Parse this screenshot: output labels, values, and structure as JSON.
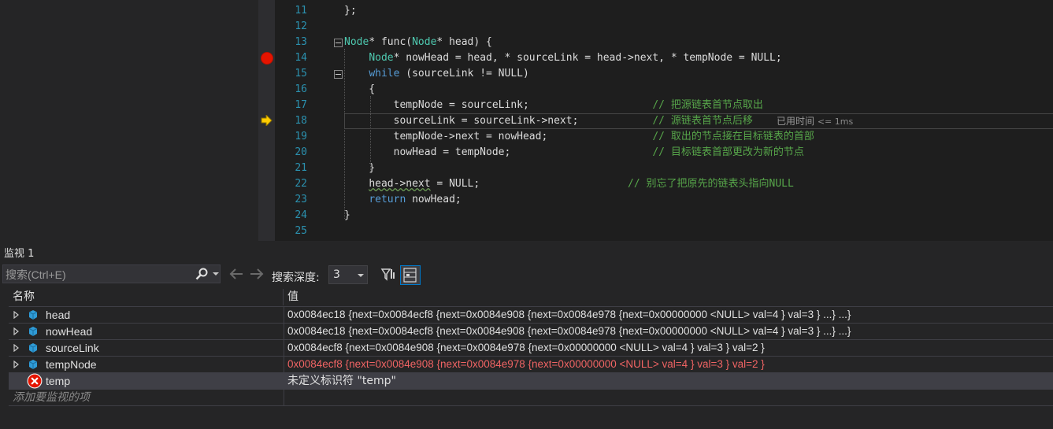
{
  "editor": {
    "lines": [
      {
        "num": "11",
        "parts": [
          {
            "t": "};",
            "c": "pl"
          }
        ]
      },
      {
        "num": "12",
        "parts": []
      },
      {
        "num": "13",
        "parts": [
          {
            "t": "Node",
            "c": "ty"
          },
          {
            "t": "* func(",
            "c": "pl"
          },
          {
            "t": "Node",
            "c": "ty"
          },
          {
            "t": "* head) {",
            "c": "pl"
          }
        ]
      },
      {
        "num": "14",
        "parts": [
          {
            "t": "    ",
            "c": "pl"
          },
          {
            "t": "Node",
            "c": "ty"
          },
          {
            "t": "* nowHead = head, * sourceLink = head->next, * tempNode = NULL;",
            "c": "pl"
          }
        ]
      },
      {
        "num": "15",
        "parts": [
          {
            "t": "    ",
            "c": "pl"
          },
          {
            "t": "while",
            "c": "kw"
          },
          {
            "t": " (sourceLink != NULL)",
            "c": "pl"
          }
        ]
      },
      {
        "num": "16",
        "parts": [
          {
            "t": "    {",
            "c": "pl"
          }
        ]
      },
      {
        "num": "17",
        "parts": [
          {
            "t": "        tempNode = sourceLink;                    ",
            "c": "pl"
          },
          {
            "t": "// 把源链表首节点取出",
            "c": "cm"
          }
        ]
      },
      {
        "num": "18",
        "parts": [
          {
            "t": "        sourceLink = sourceLink->next;            ",
            "c": "pl"
          },
          {
            "t": "// 源链表首节点后移",
            "c": "cm"
          }
        ]
      },
      {
        "num": "19",
        "parts": [
          {
            "t": "        tempNode->next = nowHead;                 ",
            "c": "pl"
          },
          {
            "t": "// 取出的节点接在目标链表的首部",
            "c": "cm"
          }
        ]
      },
      {
        "num": "20",
        "parts": [
          {
            "t": "        nowHead = tempNode;                       ",
            "c": "pl"
          },
          {
            "t": "// 目标链表首部更改为新的节点",
            "c": "cm"
          }
        ]
      },
      {
        "num": "21",
        "parts": [
          {
            "t": "    }",
            "c": "pl"
          }
        ]
      },
      {
        "num": "22",
        "parts": [
          {
            "t": "    ",
            "c": "pl"
          },
          {
            "t": "head->next",
            "c": "sq"
          },
          {
            "t": " = NULL;                        ",
            "c": "pl"
          },
          {
            "t": "// 别忘了把原先的链表头指向NULL",
            "c": "cm"
          }
        ]
      },
      {
        "num": "23",
        "parts": [
          {
            "t": "    ",
            "c": "pl"
          },
          {
            "t": "return",
            "c": "kw"
          },
          {
            "t": " nowHead;",
            "c": "pl"
          }
        ]
      },
      {
        "num": "24",
        "parts": [
          {
            "t": "}",
            "c": "pl"
          }
        ]
      },
      {
        "num": "25",
        "parts": []
      }
    ],
    "elapsed_label": "已用时间",
    "elapsed_value": "<= 1ms"
  },
  "watch": {
    "title": "监视 1",
    "search_placeholder": "搜索(Ctrl+E)",
    "depth_label": "搜索深度:",
    "depth_value": "3",
    "col_name": "名称",
    "col_value": "值",
    "rows": [
      {
        "name": "head",
        "value": "0x0084ec18 {next=0x0084ecf8 {next=0x0084e908 {next=0x0084e978 {next=0x00000000 <NULL> val=4 } val=3 } ...} ...}",
        "icon": "variable-cube-icon",
        "expandable": true,
        "changed": false
      },
      {
        "name": "nowHead",
        "value": "0x0084ec18 {next=0x0084ecf8 {next=0x0084e908 {next=0x0084e978 {next=0x00000000 <NULL> val=4 } val=3 } ...} ...}",
        "icon": "variable-cube-icon",
        "expandable": true,
        "changed": false
      },
      {
        "name": "sourceLink",
        "value": "0x0084ecf8 {next=0x0084e908 {next=0x0084e978 {next=0x00000000 <NULL> val=4 } val=3 } val=2 }",
        "icon": "variable-cube-icon",
        "expandable": true,
        "changed": false
      },
      {
        "name": "tempNode",
        "value": "0x0084ecf8 {next=0x0084e908 {next=0x0084e978 {next=0x00000000 <NULL> val=4 } val=3 } val=2 }",
        "icon": "variable-cube-icon",
        "expandable": true,
        "changed": true
      },
      {
        "name": "temp",
        "value": "未定义标识符 \"temp\"",
        "icon": "error-icon",
        "expandable": false,
        "changed": false
      }
    ],
    "add_hint": "添加要监视的项"
  },
  "colors": {
    "keyword": "#569cd6",
    "type": "#4ec9b0",
    "comment": "#57a64a",
    "changed_value": "#f06464",
    "breakpoint": "#e51400",
    "current_arrow": "#ffcc00"
  }
}
